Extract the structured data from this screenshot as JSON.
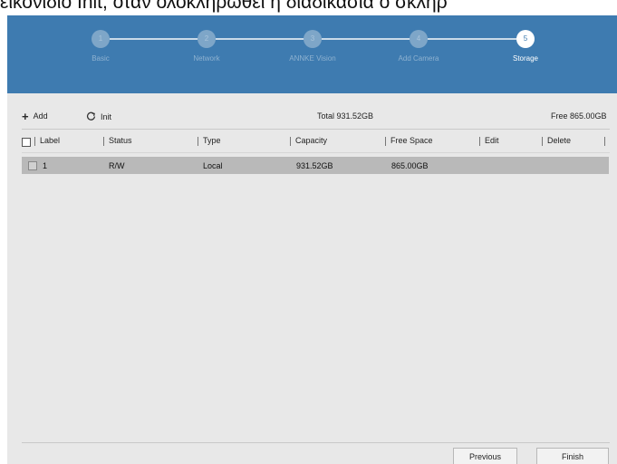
{
  "caption": "εικονίδιο Init, όταν ολοκληρωθεί η διαδικασία ο σκληρ",
  "wizard": {
    "steps": [
      {
        "number": "1",
        "label": "Basic"
      },
      {
        "number": "2",
        "label": "Network"
      },
      {
        "number": "3",
        "label": "ANNKE Vision"
      },
      {
        "number": "4",
        "label": "Add Camera"
      },
      {
        "number": "5",
        "label": "Storage"
      }
    ],
    "active_step": 5
  },
  "toolbar": {
    "add_label": "Add",
    "init_label": "Init",
    "total": "Total 931.52GB",
    "free": "Free 865.00GB"
  },
  "table": {
    "columns": [
      "Label",
      "Status",
      "Type",
      "Capacity",
      "Free Space",
      "Edit",
      "Delete"
    ],
    "rows": [
      {
        "label": "1",
        "status": "R/W",
        "type": "Local",
        "capacity": "931.52GB",
        "free_space": "865.00GB",
        "edit": "",
        "delete": ""
      }
    ]
  },
  "footer": {
    "previous_label": "Previous",
    "finish_label": "Finish"
  },
  "colors": {
    "header_blue": "#3e7bb0",
    "panel_gray": "#e8e8e8",
    "selected_row": "#b9b9b9"
  }
}
